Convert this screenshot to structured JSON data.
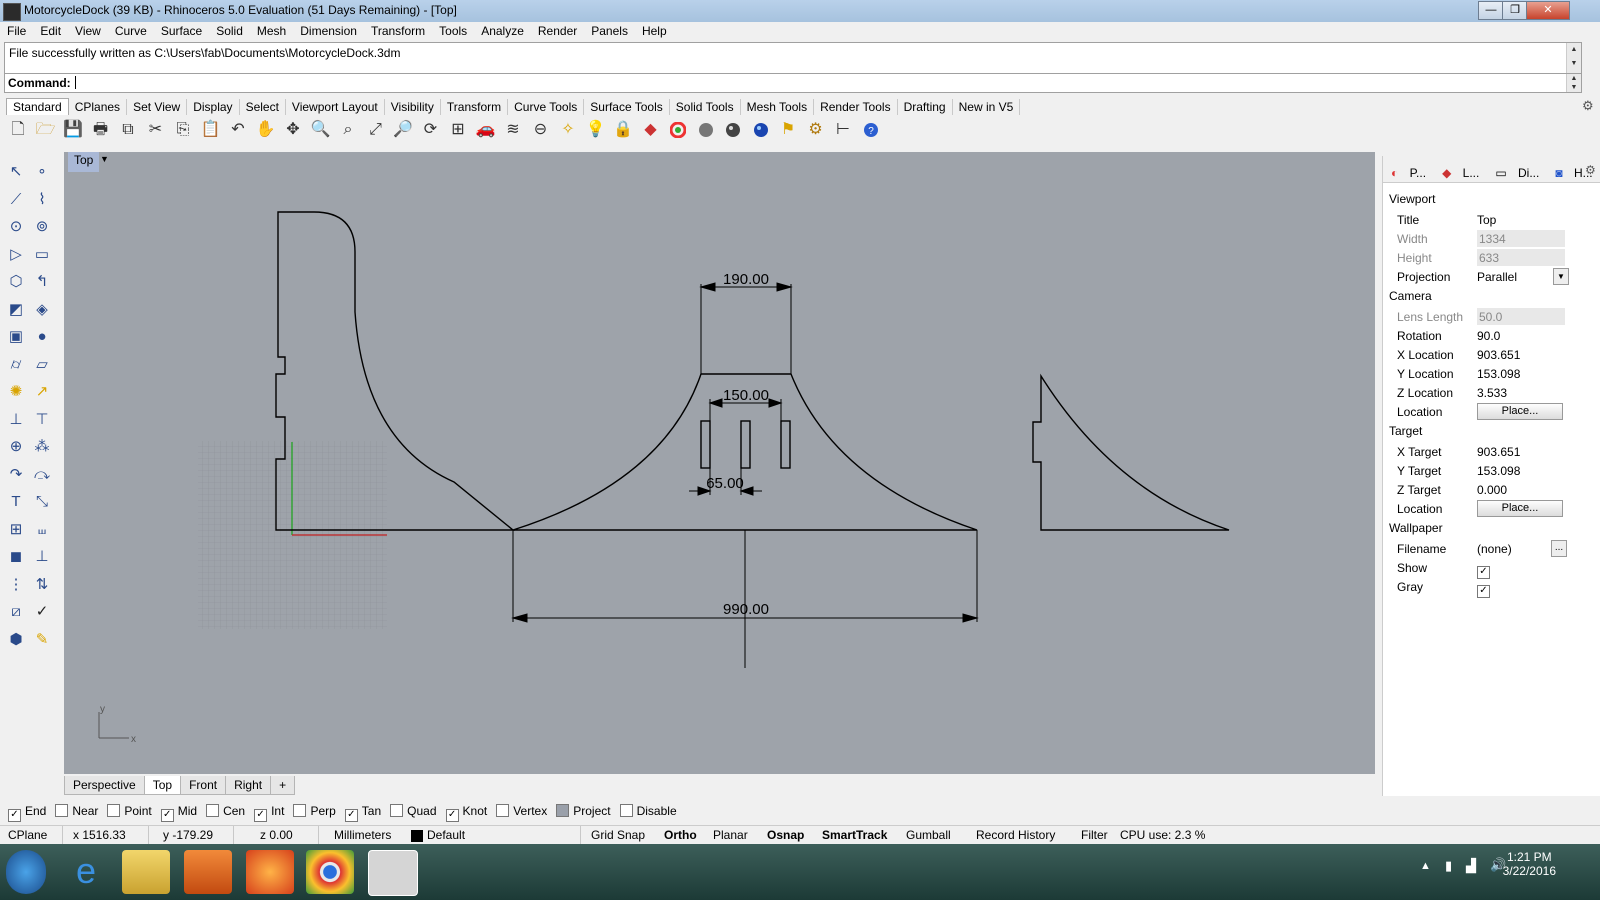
{
  "window": {
    "title": "MotorcycleDock (39 KB) - Rhinoceros 5.0 Evaluation (51 Days Remaining) - [Top]",
    "minimize": "—",
    "maximize": "❐",
    "close": "✕"
  },
  "menu": [
    "File",
    "Edit",
    "View",
    "Curve",
    "Surface",
    "Solid",
    "Mesh",
    "Dimension",
    "Transform",
    "Tools",
    "Analyze",
    "Render",
    "Panels",
    "Help"
  ],
  "history": {
    "line": "File successfully written as C:\\Users\\fab\\Documents\\MotorcycleDock.3dm"
  },
  "command": {
    "label": "Command:",
    "value": ""
  },
  "toolbar_tabs": [
    "Standard",
    "CPlanes",
    "Set View",
    "Display",
    "Select",
    "Viewport Layout",
    "Visibility",
    "Transform",
    "Curve Tools",
    "Surface Tools",
    "Solid Tools",
    "Mesh Tools",
    "Render Tools",
    "Drafting",
    "New in V5"
  ],
  "active_toolbar_tab": "Standard",
  "toolbar_icons": [
    "new-file-icon",
    "open-folder-icon",
    "save-icon",
    "print-icon",
    "import-icon",
    "cut-icon",
    "copy-icon",
    "paste-icon",
    "undo-icon",
    "pan-hand-icon",
    "move-view-icon",
    "zoom-icon",
    "zoom-window-icon",
    "zoom-extents-icon",
    "zoom-selected-icon",
    "rotate-view-icon",
    "four-viewports-icon",
    "car-icon",
    "layer-icon",
    "select-icon",
    "properties-icon",
    "light-icon",
    "lock-icon",
    "materials-icon",
    "color-wheel-icon",
    "shaded-sphere-icon",
    "rendered-sphere-icon",
    "render-sphere-icon",
    "options-icon",
    "gear-icon",
    "dimension-icon",
    "help-icon"
  ],
  "viewport": {
    "label": "Top",
    "dimensions": {
      "top_width": "190.00",
      "slot_spacing": "150.00",
      "slot_width": "65.00",
      "base_width": "990.00"
    },
    "axis_x": "x",
    "axis_y": "y"
  },
  "viewport_tabs": [
    "Perspective",
    "Top",
    "Front",
    "Right"
  ],
  "active_viewport_tab": "Top",
  "add_viewport": "+",
  "osnap": [
    {
      "label": "End",
      "checked": true
    },
    {
      "label": "Near",
      "checked": false
    },
    {
      "label": "Point",
      "checked": false
    },
    {
      "label": "Mid",
      "checked": true
    },
    {
      "label": "Cen",
      "checked": false
    },
    {
      "label": "Int",
      "checked": true
    },
    {
      "label": "Perp",
      "checked": false
    },
    {
      "label": "Tan",
      "checked": true
    },
    {
      "label": "Quad",
      "checked": false
    },
    {
      "label": "Knot",
      "checked": true
    },
    {
      "label": "Vertex",
      "checked": false
    },
    {
      "label": "Project",
      "checked": false
    },
    {
      "label": "Disable",
      "checked": false
    }
  ],
  "status": {
    "cplane": "CPlane",
    "x": "x 1516.33",
    "y": "y -179.29",
    "z": "z 0.00",
    "units": "Millimeters",
    "layer": "Default",
    "grid_snap": "Grid Snap",
    "ortho": "Ortho",
    "planar": "Planar",
    "osnap": "Osnap",
    "smarttrack": "SmartTrack",
    "gumball": "Gumball",
    "record_history": "Record History",
    "filter": "Filter",
    "cpu": "CPU use: 2.3 %"
  },
  "panel": {
    "tabs": [
      "P...",
      "L...",
      "Di...",
      "H..."
    ],
    "sections": {
      "viewport": "Viewport",
      "camera": "Camera",
      "target": "Target",
      "wallpaper": "Wallpaper"
    },
    "viewport_rows": [
      {
        "key": "Title",
        "value": "Top"
      },
      {
        "key": "Width",
        "value": "1334"
      },
      {
        "key": "Height",
        "value": "633"
      },
      {
        "key": "Projection",
        "value": "Parallel"
      }
    ],
    "camera_rows": [
      {
        "key": "Lens Length",
        "value": "50.0"
      },
      {
        "key": "Rotation",
        "value": "90.0"
      },
      {
        "key": "X Location",
        "value": "903.651"
      },
      {
        "key": "Y Location",
        "value": "153.098"
      },
      {
        "key": "Z Location",
        "value": "3.533"
      },
      {
        "key": "Location",
        "value": "Place..."
      }
    ],
    "target_rows": [
      {
        "key": "X Target",
        "value": "903.651"
      },
      {
        "key": "Y Target",
        "value": "153.098"
      },
      {
        "key": "Z Target",
        "value": "0.000"
      },
      {
        "key": "Location",
        "value": "Place..."
      }
    ],
    "wallpaper_rows": [
      {
        "key": "Filename",
        "value": "(none)"
      },
      {
        "key": "Show",
        "value": ""
      },
      {
        "key": "Gray",
        "value": ""
      }
    ],
    "browse": "...",
    "show_checked": true,
    "gray_checked": true
  },
  "taskbar": {
    "time": "1:21 PM",
    "date": "3/22/2016"
  }
}
